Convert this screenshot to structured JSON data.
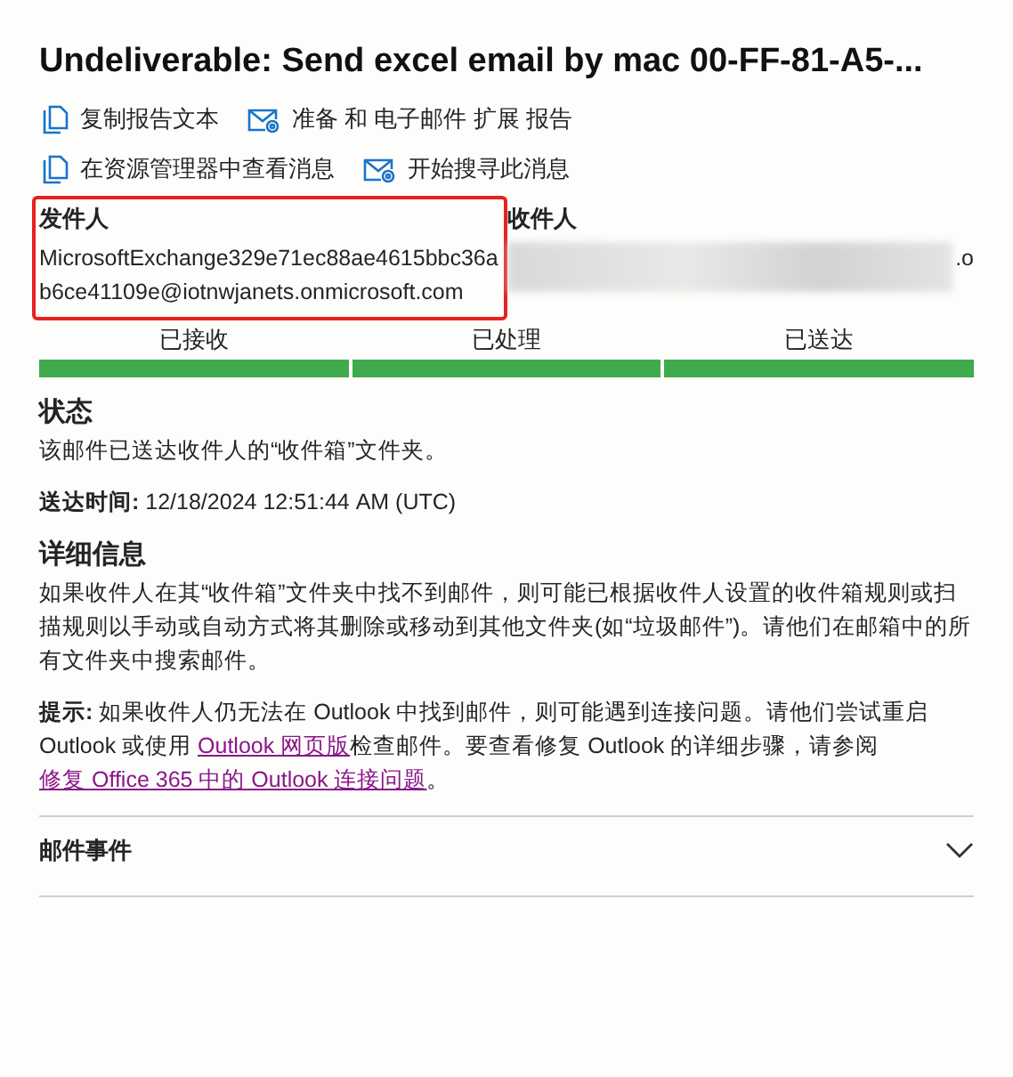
{
  "title": "Undeliverable: Send excel email by mac 00-FF-81-A5-...",
  "actions": [
    {
      "kind": "copy",
      "label": "复制报告文本"
    },
    {
      "kind": "mail",
      "label": "准备 和 电子邮件 扩展 报告"
    },
    {
      "kind": "copy",
      "label": "在资源管理器中查看消息"
    },
    {
      "kind": "mail",
      "label": "开始搜寻此消息"
    }
  ],
  "sender": {
    "label": "发件人",
    "value": "MicrosoftExchange329e71ec88ae4615bbc36ab6ce41109e@iotnwjanets.onmicrosoft.com",
    "highlighted": true
  },
  "recipient": {
    "label": "收件人",
    "value_visible_tail": ".o",
    "redacted": true
  },
  "steps": [
    {
      "label": "已接收",
      "completed": true
    },
    {
      "label": "已处理",
      "completed": true
    },
    {
      "label": "已送达",
      "completed": true
    }
  ],
  "status": {
    "heading": "状态",
    "text": "该邮件已送达收件人的“收件箱”文件夹。"
  },
  "delivered": {
    "label": "送达时间:",
    "value": "12/18/2024 12:51:44 AM (UTC)"
  },
  "details": {
    "heading": "详细信息",
    "text": "如果收件人在其“收件箱”文件夹中找不到邮件，则可能已根据收件人设置的收件箱规则或扫描规则以手动或自动方式将其删除或移动到其他文件夹(如“垃圾邮件”)。请他们在邮箱中的所有文件夹中搜索邮件。"
  },
  "tip": [
    {
      "kind": "text",
      "text": "**提示:** 如果收件人仍无法在 Outlook 中找到邮件，则可能遇到连接问题。请他们尝试重启 Outlook 或使用 "
    },
    {
      "kind": "link",
      "text": "Outlook 网页版"
    },
    {
      "kind": "text",
      "text": "检查邮件。要查看修复 Outlook 的详细步骤，请参阅"
    },
    {
      "kind": "link",
      "text": "修复 Office 365 中的 Outlook 连接问题"
    },
    {
      "kind": "text",
      "text": "。"
    }
  ],
  "events": {
    "label": "邮件事件",
    "expanded": false
  }
}
